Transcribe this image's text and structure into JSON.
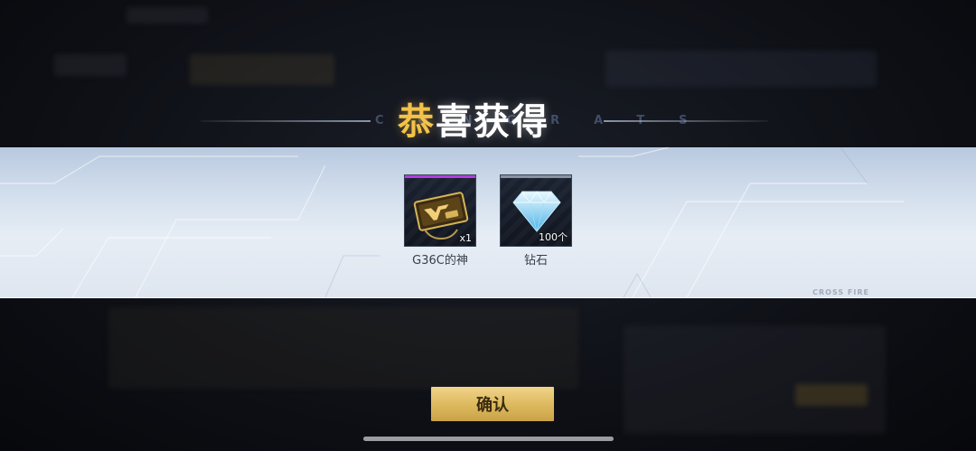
{
  "dialog": {
    "title_first_char": "恭",
    "title_rest": "喜获得",
    "title_bg_letters": "CONGRATS",
    "brand_text": "CROSS FIRE"
  },
  "rewards": [
    {
      "name": "G36C的神",
      "quantity": "x1",
      "icon": "cf-crate-ticket-icon",
      "rarity_color": "#b23ee0"
    },
    {
      "name": "钻石",
      "quantity": "100个",
      "icon": "diamond-icon",
      "rarity_color": "#8a93a3"
    }
  ],
  "confirm_button": {
    "label": "确认"
  },
  "colors": {
    "title_accent": "#f3c24a",
    "button_gold": "#dcb85c"
  }
}
